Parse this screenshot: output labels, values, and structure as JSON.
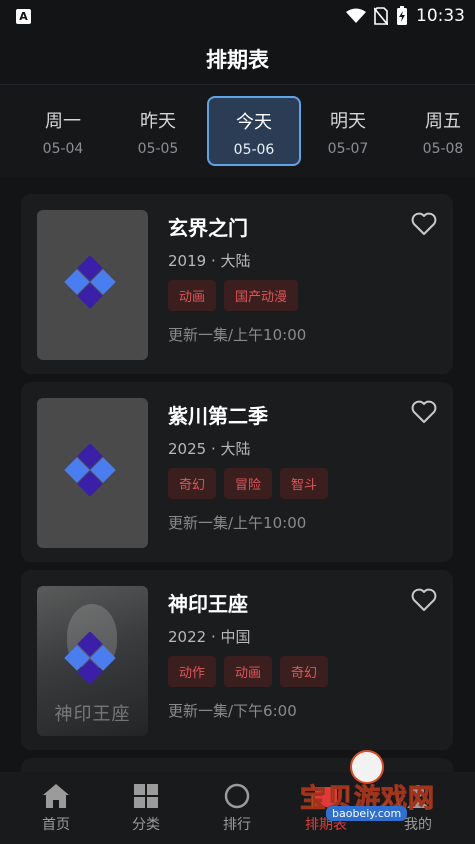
{
  "status_bar": {
    "time": "10:33"
  },
  "header": {
    "title": "排期表"
  },
  "days": [
    {
      "name": "周一",
      "date": "05-04",
      "active": false
    },
    {
      "name": "昨天",
      "date": "05-05",
      "active": false
    },
    {
      "name": "今天",
      "date": "05-06",
      "active": true
    },
    {
      "name": "明天",
      "date": "05-07",
      "active": false
    },
    {
      "name": "周五",
      "date": "05-08",
      "active": false
    }
  ],
  "cards": [
    {
      "title": "玄界之门",
      "meta": "2019 · 大陆",
      "tags": [
        "动画",
        "国产动漫"
      ],
      "update": "更新一集/上午10:00"
    },
    {
      "title": "紫川第二季",
      "meta": "2025 · 大陆",
      "tags": [
        "奇幻",
        "冒险",
        "智斗"
      ],
      "update": "更新一集/上午10:00"
    },
    {
      "title": "神印王座",
      "meta": "2022 · 中国",
      "tags": [
        "动作",
        "动画",
        "奇幻"
      ],
      "update": "更新一集/下午6:00",
      "poster_caption": "神印王座"
    }
  ],
  "tabs": [
    {
      "label": "首页",
      "icon": "home-icon"
    },
    {
      "label": "分类",
      "icon": "grid-icon"
    },
    {
      "label": "排行",
      "icon": "ranking-icon"
    },
    {
      "label": "排期表",
      "icon": "calendar-icon",
      "active": true
    },
    {
      "label": "我的",
      "icon": "profile-icon"
    }
  ],
  "watermark": {
    "text": "宝贝游戏网",
    "url": "baobeiy.com"
  },
  "colors": {
    "accent": "#e23a3a",
    "active_day_border": "#60a4e8",
    "tag_text": "#e05656"
  }
}
